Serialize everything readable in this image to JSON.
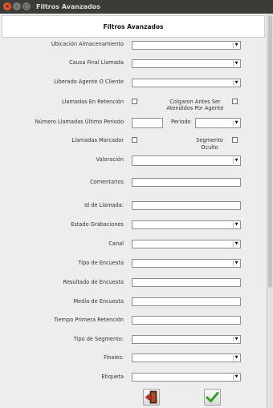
{
  "window": {
    "title": "Filtros Avanzados"
  },
  "header": {
    "title": "Filtros Avanzados"
  },
  "form": {
    "ubicacion": {
      "label": "Ubicación Almacenamiento",
      "value": ""
    },
    "causa_final": {
      "label": "Causa Final Llamada",
      "value": ""
    },
    "liberado": {
      "label": "Liberado Agente O Cliente",
      "value": ""
    },
    "llamadas_retencion": {
      "label": "Llamadas En Retención",
      "checked": false
    },
    "colgaron": {
      "label_line1": "Colgaron Antes Ser",
      "label_line2": "Atendidos Por Agente",
      "checked": false
    },
    "numero_llamadas": {
      "label": "Número Llamadas Último Periodo",
      "value": ""
    },
    "periodo": {
      "label": "Periodo",
      "value": ""
    },
    "llamadas_marcador": {
      "label": "Llamadas Marcador",
      "checked": false
    },
    "segmento_oculto": {
      "label_line1": "Segmento",
      "label_line2": "Oculto",
      "checked": false
    },
    "valoracion": {
      "label": "Valoración",
      "value": ""
    },
    "comentarios": {
      "label": "Comentarios",
      "value": ""
    },
    "id_llamada": {
      "label": "Id de Llamada:",
      "value": ""
    },
    "estado_grabaciones": {
      "label": "Estado Grabaciones",
      "value": ""
    },
    "canal": {
      "label": "Canal",
      "value": ""
    },
    "tipo_encuesta": {
      "label": "Tipo de Encuesta",
      "value": ""
    },
    "resultado_encuesta": {
      "label": "Resultado de Encuesta",
      "value": ""
    },
    "media_encuesta": {
      "label": "Media de Encuesta",
      "value": ""
    },
    "tiempo_primera_retencion": {
      "label": "Tiempo Primera Retención",
      "value": ""
    },
    "tipo_segmento": {
      "label": "Tipo de Segmento:",
      "value": ""
    },
    "finales": {
      "label": "Finales:",
      "value": ""
    },
    "etiqueta": {
      "label": "Etiqueta",
      "value": ""
    }
  },
  "buttons": {
    "exit_icon": "exit-door-icon",
    "accept_icon": "green-check-icon"
  },
  "colors": {
    "check_green": "#2fa31e",
    "exit_red": "#c8231e",
    "titlebar": "#3c3b37"
  }
}
